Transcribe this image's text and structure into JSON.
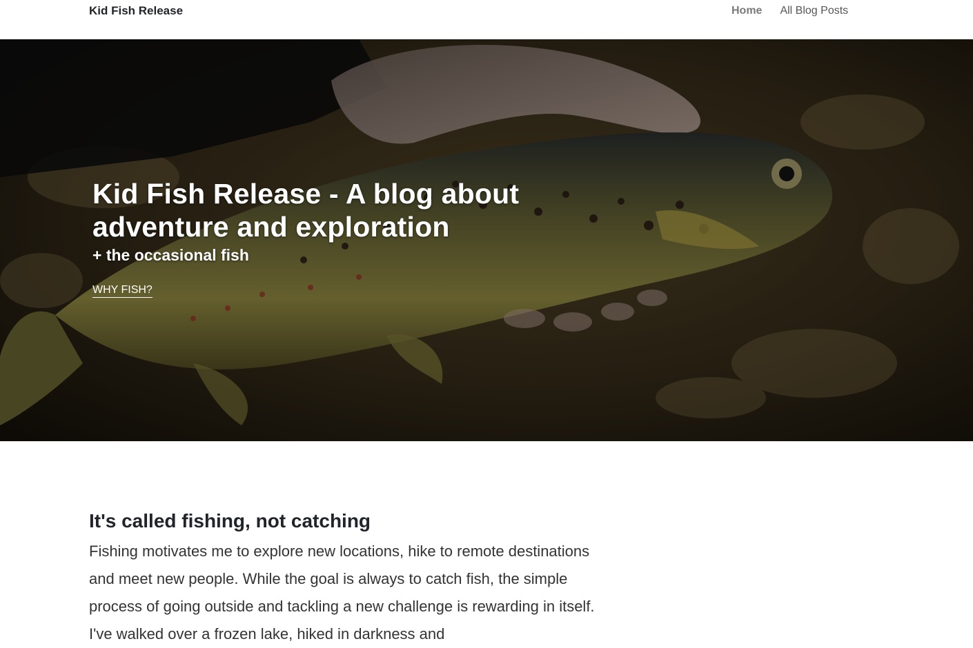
{
  "navbar": {
    "brand": "Kid Fish Release",
    "links": [
      {
        "label": "Home",
        "active": true
      },
      {
        "label": "All Blog Posts",
        "active": false
      }
    ]
  },
  "hero": {
    "title": "Kid Fish Release - A blog about adventure and exploration",
    "subtitle": "+ the occasional fish",
    "cta_label": "WHY FISH?"
  },
  "article": {
    "heading": "It's called fishing, not catching",
    "body": "Fishing motivates me to explore new locations, hike to remote destinations and meet new people. While the goal is always to catch fish, the simple process of going outside and tackling a new challenge is rewarding in itself. I've walked over a frozen lake, hiked in darkness and"
  },
  "colors": {
    "text_dark": "#212529",
    "nav_muted": "#7a7a7a",
    "hero_overlay": "#000000"
  }
}
